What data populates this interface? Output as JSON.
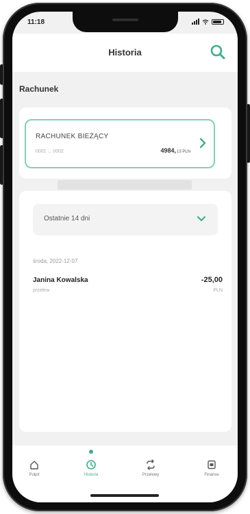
{
  "status_bar": {
    "time": "11:18"
  },
  "header": {
    "title": "Historia"
  },
  "section": {
    "label": "Rachunek"
  },
  "account": {
    "name": "RACHUNEK BIEŻĄCY",
    "number": "0001 ... 0002",
    "balance": "4984,",
    "currency": "13 PLN"
  },
  "filter": {
    "label": "Ostatnie 14 dni"
  },
  "transaction": {
    "date": "środa, 2022-12-07",
    "name": "Janina Kowalska",
    "type": "przelew",
    "amount": "-25,00",
    "currency": "PLN"
  },
  "nav": {
    "items": [
      {
        "label": "Pulpit"
      },
      {
        "label": "Historia"
      },
      {
        "label": "Przelewy"
      },
      {
        "label": "Finanse"
      }
    ]
  },
  "colors": {
    "accent": "#3fae8a",
    "card_border": "#7fd1b4"
  }
}
